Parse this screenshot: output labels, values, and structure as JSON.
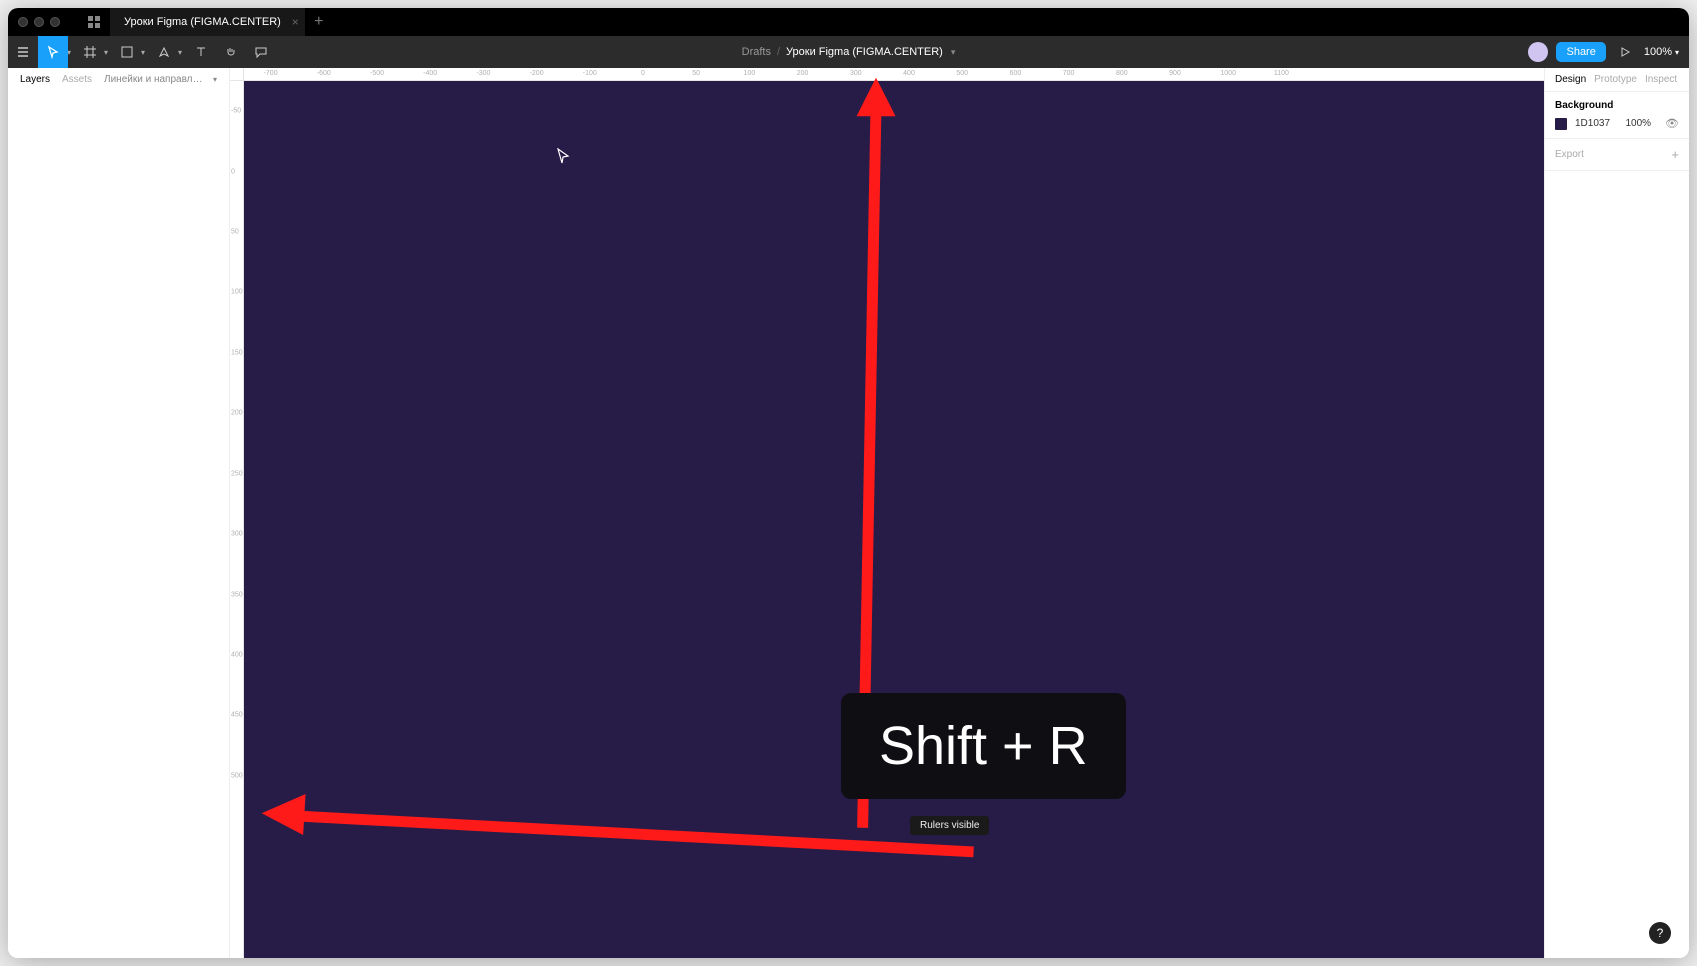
{
  "tab": {
    "title": "Уроки Figma (FIGMA.CENTER)"
  },
  "breadcrumb": {
    "drafts": "Drafts",
    "file": "Уроки Figma (FIGMA.CENTER)"
  },
  "toolbar": {
    "share_label": "Share",
    "zoom": "100%"
  },
  "left_panel": {
    "tabs": {
      "layers": "Layers",
      "assets": "Assets"
    },
    "page_name": "Линейки и направляющие (включе..."
  },
  "right_panel": {
    "tabs": {
      "design": "Design",
      "prototype": "Prototype",
      "inspect": "Inspect"
    },
    "background_label": "Background",
    "bg_hex": "1D1037",
    "bg_opacity": "100%",
    "export_label": "Export"
  },
  "ruler_top": [
    "-700",
    "-600",
    "-500",
    "-400",
    "-300",
    "-200",
    "-100",
    "0",
    "50",
    "100",
    "200",
    "300",
    "400",
    "500",
    "600",
    "700",
    "800",
    "900",
    "1000",
    "1100"
  ],
  "ruler_left": [
    "-50",
    "0",
    "50",
    "100",
    "150",
    "200",
    "250",
    "300",
    "350",
    "400",
    "450",
    "500"
  ],
  "annotation": {
    "shortcut": "Shift + R",
    "tooltip": "Rulers visible"
  },
  "help": "?"
}
